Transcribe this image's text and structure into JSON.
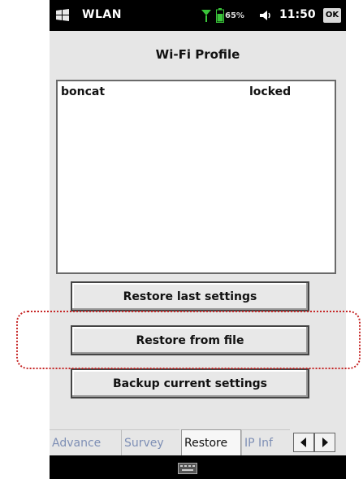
{
  "status_bar": {
    "app_name": "WLAN",
    "battery_percent": "65%",
    "time": "11:50",
    "ok_label": "OK",
    "icons": [
      "windows-flag-icon",
      "signal-icon",
      "battery-icon",
      "volume-icon"
    ]
  },
  "title": "Wi-Fi Profile",
  "profiles": [
    {
      "name": "boncat",
      "status": "locked"
    }
  ],
  "buttons": {
    "restore_last": "Restore last settings",
    "restore_from_file": "Restore from file",
    "backup_current": "Backup current settings"
  },
  "tabs": [
    {
      "label": "Advance",
      "active": false
    },
    {
      "label": "Survey",
      "active": false
    },
    {
      "label": "Restore",
      "active": true
    },
    {
      "label": "IP Inf",
      "active": false
    }
  ],
  "colors": {
    "highlight": "#c62828",
    "inactive_tab_text": "#7e8fb5"
  }
}
